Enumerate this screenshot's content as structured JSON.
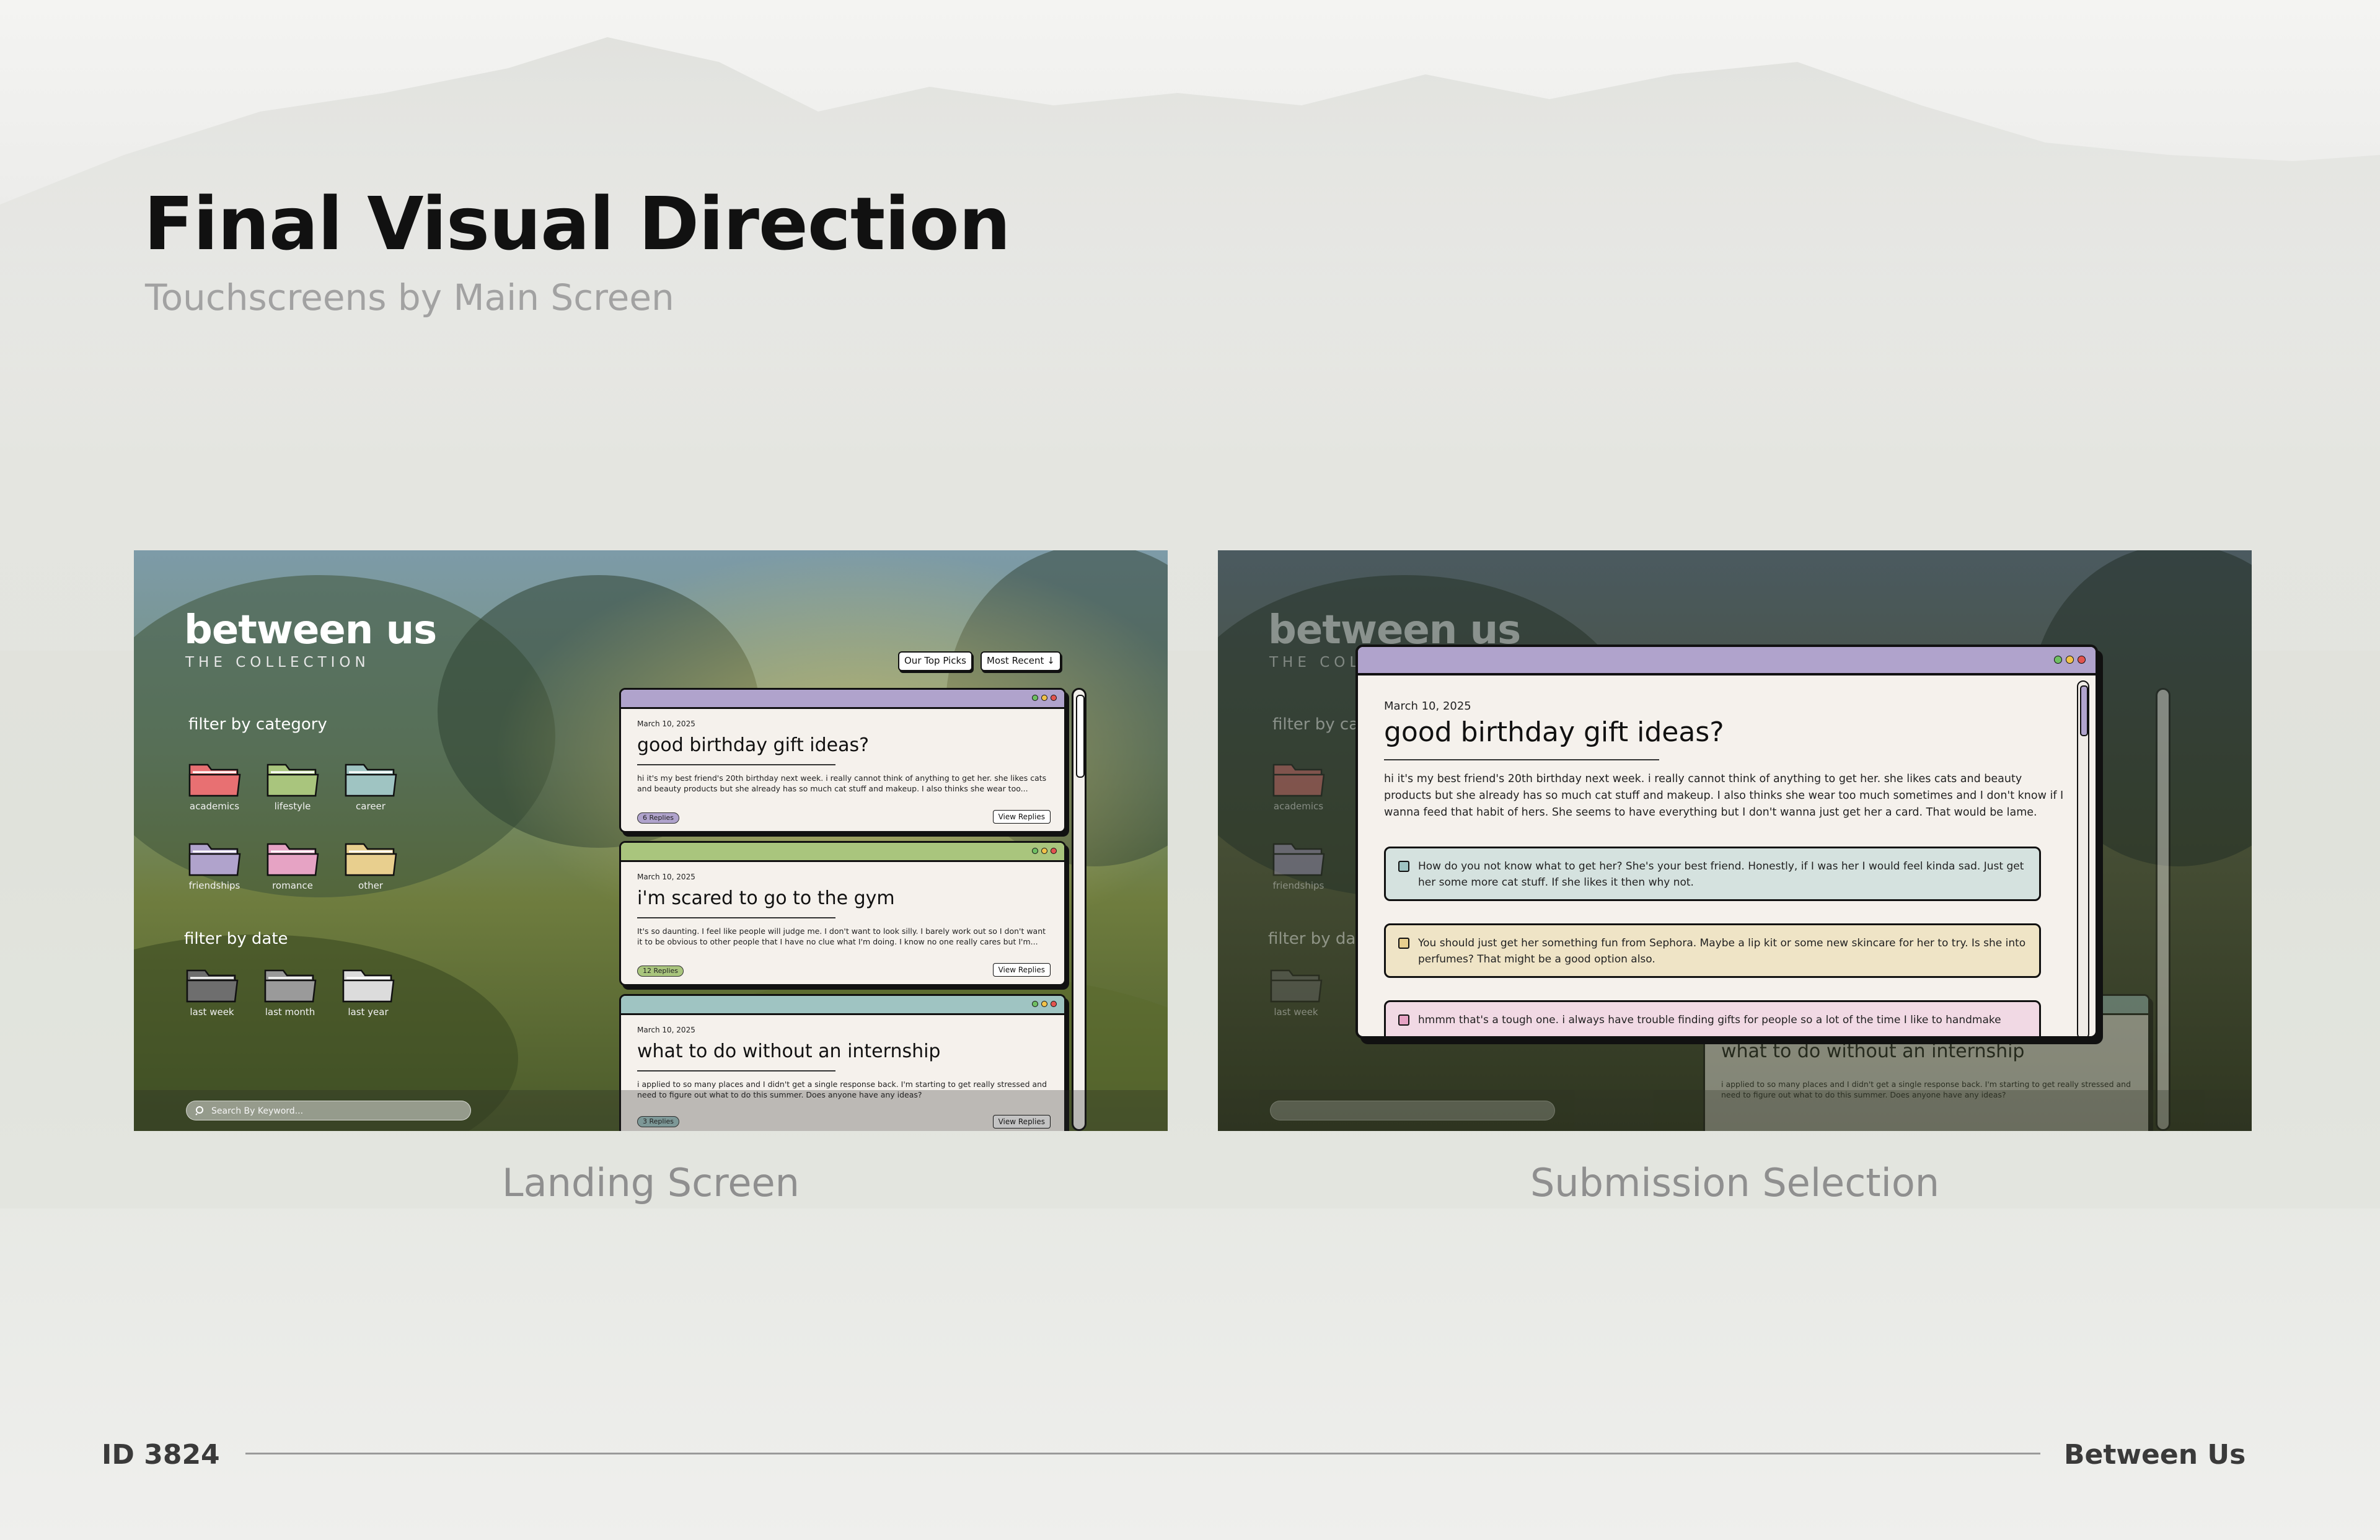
{
  "page": {
    "title": "Final Visual Direction",
    "subtitle": "Touchscreens by Main Screen"
  },
  "captions": {
    "landing": "Landing Screen",
    "submission": "Submission Selection"
  },
  "footer": {
    "id": "ID 3824",
    "brand": "Between Us"
  },
  "app": {
    "brand": "between us",
    "brand_sub": "THE COLLECTION",
    "filter_category_label": "filter by category",
    "filter_date_label": "filter by date",
    "categories": [
      {
        "label": "academics",
        "color": "#e87072"
      },
      {
        "label": "lifestyle",
        "color": "#a9c57d"
      },
      {
        "label": "career",
        "color": "#9fc4c2"
      },
      {
        "label": "friendships",
        "color": "#b0a3cc"
      },
      {
        "label": "romance",
        "color": "#e6a3c4"
      },
      {
        "label": "other",
        "color": "#e8cf8e"
      }
    ],
    "dates": [
      {
        "label": "last week",
        "color": "#6e6e6e"
      },
      {
        "label": "last month",
        "color": "#9a9a9a"
      },
      {
        "label": "last year",
        "color": "#dcdcdc"
      }
    ],
    "sort_buttons": {
      "top_picks": "Our Top Picks",
      "most_recent": "Most Recent"
    },
    "search": {
      "placeholder": "Search By Keyword..."
    },
    "posts": [
      {
        "date": "March 10, 2025",
        "title": "good birthday gift ideas?",
        "body": "hi it's my best friend's 20th birthday next week. i really cannot think of anything to get her. she likes cats and beauty products but she already has so much cat stuff and makeup. I also thinks she wear too...",
        "replies": "6 Replies",
        "view": "View Replies",
        "color": "#b0a3cc"
      },
      {
        "date": "March 10, 2025",
        "title": "i'm scared to go to the gym",
        "body": "It's so daunting. I feel like people will judge me. I don't want to look silly. I barely work out so I don't want it to be obvious to other people that I have no clue what I'm doing. I know no one really cares but I'm...",
        "replies": "12 Replies",
        "view": "View Replies",
        "color": "#a9c57d"
      },
      {
        "date": "March 10, 2025",
        "title": "what to do without an internship",
        "body": "i applied to so many places and I didn't get a single response back. I'm starting to get really stressed and need to figure out what to do this summer. Does anyone have any ideas?",
        "replies": "3 Replies",
        "view": "View Replies",
        "color": "#9fc4c2"
      }
    ],
    "modal": {
      "date": "March 10, 2025",
      "title": "good birthday gift ideas?",
      "body": "hi it's my best friend's 20th birthday next week. i really cannot think of anything to get her. she likes cats and beauty products but she already has so much cat stuff and makeup. I also thinks she wear too much sometimes and I don't know if I wanna feed that habit of hers. She seems to have everything but I don't wanna just get her a card. That would be lame.",
      "replies": [
        {
          "text": "How do you not know what to get her? She's your best friend. Honestly, if I was her I would feel kinda sad. Just get her some more cat stuff. If she likes it then why not.",
          "color": "#d5e2df",
          "check": "#9fc4c2"
        },
        {
          "text": "You should just get her something fun from Sephora. Maybe a lip kit or some new skincare for her to try. Is she into perfumes? That might be a good option also.",
          "color": "#efe4c6",
          "check": "#e8cf8e"
        },
        {
          "text": "hmmm that's a tough one. i always have trouble finding gifts for people so a lot of the time I like to handmake",
          "color": "#f1d9e4",
          "check": "#e6a3c4"
        }
      ]
    }
  },
  "colors": {
    "title": "#111111",
    "subtitle": "#a2a2a2",
    "caption": "#8f8f8f",
    "card_bg": "#f5f1ec",
    "dot_green": "#6fbf63",
    "dot_yellow": "#f1c24a",
    "dot_red": "#e2544f"
  }
}
